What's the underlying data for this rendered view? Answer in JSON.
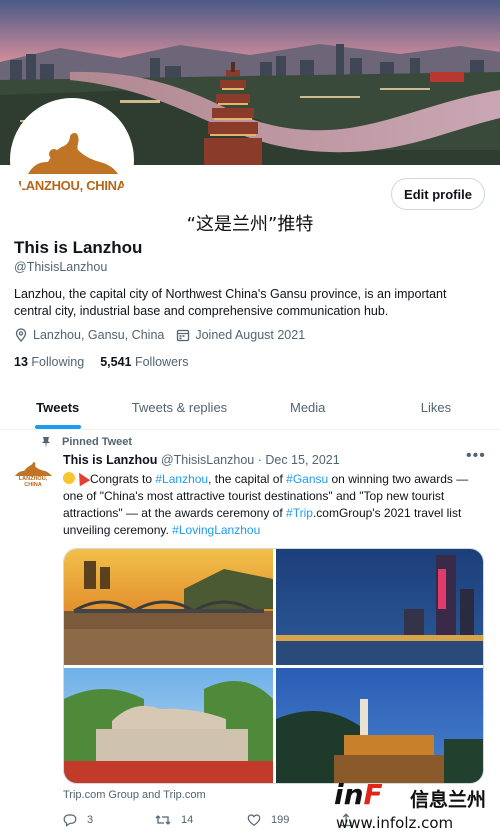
{
  "profile": {
    "avatar_label": "LANZHOU, CHINA",
    "edit_profile_label": "Edit profile",
    "page_tag": "“这是兰州”推特",
    "display_name": "This is Lanzhou",
    "handle": "@ThisisLanzhou",
    "bio": "Lanzhou, the capital city of Northwest China's Gansu province, is an important central city, industrial base and comprehensive communication hub.",
    "location": "Lanzhou, Gansu, China",
    "joined": "Joined August 2021",
    "following_count": "13",
    "following_label": "Following",
    "followers_count": "5,541",
    "followers_label": "Followers"
  },
  "tabs": [
    {
      "label": "Tweets",
      "active": true
    },
    {
      "label": "Tweets & replies",
      "active": false
    },
    {
      "label": "Media",
      "active": false
    },
    {
      "label": "Likes",
      "active": false
    }
  ],
  "tweet": {
    "pinned_label": "Pinned Tweet",
    "author_name": "This is Lanzhou",
    "author_handle": "@ThisisLanzhou",
    "date": "· Dec 15, 2021",
    "avatar_label": "LANZHOU, CHINA",
    "text_1": "Congrats to ",
    "tag_lanzhou": "#Lanzhou",
    "text_2": ", the capital of ",
    "tag_gansu": "#Gansu",
    "text_3": " on winning two awards — one of \"China's most attractive tourist destinations\" and \"Top new tourist attractions\" — at the awards ceremony of ",
    "tag_trip": "#Trip",
    "text_4": ".comGroup's 2021 travel list unveiling ceremony. ",
    "tag_loving": "#LovingLanzhou",
    "media_credit": "Trip.com Group and Trip.com",
    "reply_count": "3",
    "retweet_count": "14",
    "like_count": "199"
  },
  "watermark": {
    "brand_in": "in",
    "brand_f": "F",
    "brand_cn": "信息兰州",
    "url": "www.infolz.com"
  },
  "colors": {
    "accent": "#1d9bf0",
    "text_primary": "#0f1419",
    "text_secondary": "#536471",
    "brand_orange": "#b5661b"
  },
  "icons": [
    "pin-icon",
    "location-icon",
    "calendar-icon",
    "more-icon",
    "reply-icon",
    "retweet-icon",
    "like-icon",
    "share-icon"
  ]
}
